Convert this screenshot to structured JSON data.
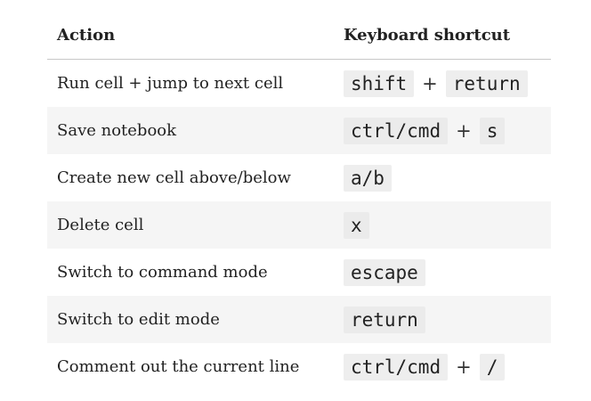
{
  "table": {
    "headers": {
      "action": "Action",
      "shortcut": "Keyboard shortcut"
    },
    "separator": "+",
    "rows": [
      {
        "action": "Run cell + jump to next cell",
        "keys": [
          "shift",
          "return"
        ]
      },
      {
        "action": "Save notebook",
        "keys": [
          "ctrl/cmd",
          "s"
        ]
      },
      {
        "action": "Create new cell above/below",
        "keys": [
          "a/b"
        ]
      },
      {
        "action": "Delete cell",
        "keys": [
          "x"
        ]
      },
      {
        "action": "Switch to command mode",
        "keys": [
          "escape"
        ]
      },
      {
        "action": "Switch to edit mode",
        "keys": [
          "return"
        ]
      },
      {
        "action": "Comment out the current line",
        "keys": [
          "ctrl/cmd",
          "/"
        ]
      }
    ]
  }
}
